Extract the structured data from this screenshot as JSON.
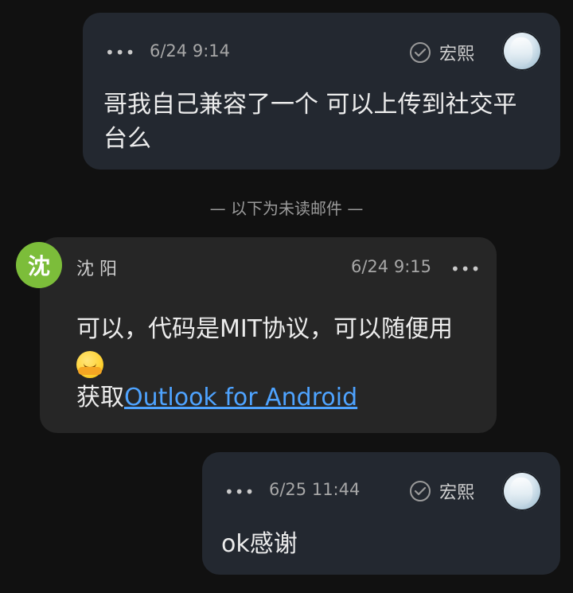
{
  "messages": [
    {
      "id": "m1",
      "more": "•••",
      "time": "6/24 9:14",
      "sender": "宏熙",
      "body_line1": "哥我自己兼容了一个 可以上传到社交平",
      "body_line2": "台么"
    },
    {
      "id": "m2",
      "avatar_initial": "沈",
      "sender": "沈 阳",
      "time": "6/24 9:15",
      "more": "•••",
      "body_line1": "可以，代码是MIT协议，可以随便用",
      "sig_prefix": "获取",
      "sig_link": "Outlook for Android"
    },
    {
      "id": "m3",
      "more": "•••",
      "time": "6/25 11:44",
      "sender": "宏熙",
      "body_line1": "ok感谢"
    }
  ],
  "divider": "— 以下为未读邮件 —",
  "colors": {
    "background": "#111111",
    "outgoing_bubble": "#232830",
    "incoming_bubble": "#262626",
    "avatar_green": "#7cbd3a",
    "link": "#4ea3ff"
  }
}
